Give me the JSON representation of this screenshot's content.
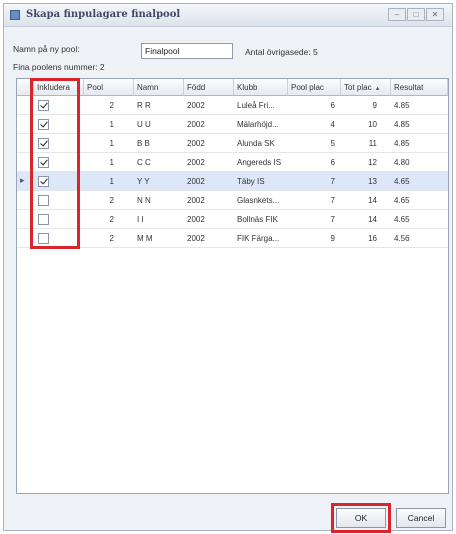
{
  "window": {
    "title": "Skapa finpulagare finalpool",
    "controls": {
      "minimize": "–",
      "maximize": "□",
      "close": "✕"
    }
  },
  "form": {
    "name_label": "Namn på ny pool:",
    "name_value": "Finalpool",
    "count_label": "Antal övrigasede: 5",
    "pool_numbers_label": "Fina poolens nummer: 2"
  },
  "grid": {
    "columns": [
      "Inkludera",
      "Pool",
      "Namn",
      "Född",
      "Klubb",
      "Pool plac",
      "Tot plac",
      "Resultat"
    ],
    "sort_indicator": "▲",
    "rows": [
      {
        "included": true,
        "pool": "2",
        "name": "R R",
        "born": "2002",
        "club": "Luleå Fri...",
        "pool_place": "6",
        "tot_place": "9",
        "result": "4.85",
        "selected": false
      },
      {
        "included": true,
        "pool": "1",
        "name": "U U",
        "born": "2002",
        "club": "Mälarhöjd...",
        "pool_place": "4",
        "tot_place": "10",
        "result": "4.85",
        "selected": false
      },
      {
        "included": true,
        "pool": "1",
        "name": "B B",
        "born": "2002",
        "club": "Alunda SK",
        "pool_place": "5",
        "tot_place": "11",
        "result": "4.85",
        "selected": false
      },
      {
        "included": true,
        "pool": "1",
        "name": "C C",
        "born": "2002",
        "club": "Angereds IS",
        "pool_place": "6",
        "tot_place": "12",
        "result": "4.80",
        "selected": false
      },
      {
        "included": true,
        "pool": "1",
        "name": "Y Y",
        "born": "2002",
        "club": "Täby IS",
        "pool_place": "7",
        "tot_place": "13",
        "result": "4.65",
        "selected": true
      },
      {
        "included": false,
        "pool": "2",
        "name": "N N",
        "born": "2002",
        "club": "Glasnkets...",
        "pool_place": "7",
        "tot_place": "14",
        "result": "4.65",
        "selected": false
      },
      {
        "included": false,
        "pool": "2",
        "name": "I I",
        "born": "2002",
        "club": "Bollnäs FIK",
        "pool_place": "7",
        "tot_place": "14",
        "result": "4.65",
        "selected": false
      },
      {
        "included": false,
        "pool": "2",
        "name": "M M",
        "born": "2002",
        "club": "FIK Färga...",
        "pool_place": "9",
        "tot_place": "16",
        "result": "4.56",
        "selected": false
      }
    ]
  },
  "buttons": {
    "ok": "OK",
    "cancel": "Cancel"
  },
  "colors": {
    "highlight": "#d9262d",
    "selected_row": "#dce8f8"
  }
}
